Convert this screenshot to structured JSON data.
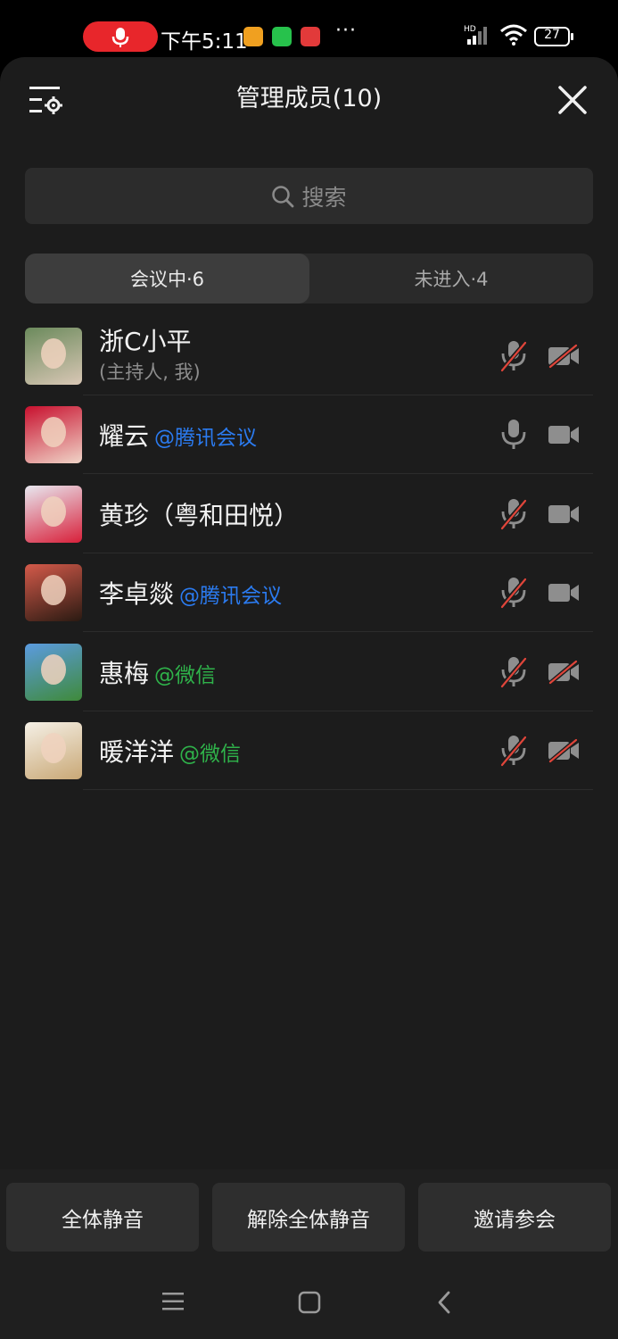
{
  "status_bar": {
    "time": "下午5:11",
    "battery": "27",
    "network": "HD",
    "more": "···"
  },
  "header": {
    "title": "管理成员(10)"
  },
  "search": {
    "placeholder": "搜索"
  },
  "tabs": [
    {
      "label": "会议中·6",
      "active": true
    },
    {
      "label": "未进入·4",
      "active": false
    }
  ],
  "members": [
    {
      "name": "浙C小平",
      "tag": "",
      "sub": "(主持人, 我)",
      "mic": "muted",
      "camera": "off",
      "avatar_colors": [
        "#6b8a5c",
        "#d9c7b5"
      ]
    },
    {
      "name": "耀云",
      "tag": "@腾讯会议",
      "tag_color": "#2b7bf0",
      "sub": "",
      "mic": "on",
      "camera": "on",
      "avatar_colors": [
        "#c8102e",
        "#f0d5c8"
      ]
    },
    {
      "name": "黄珍（粤和田悦）",
      "tag": "",
      "sub": "",
      "mic": "muted",
      "camera": "on",
      "avatar_colors": [
        "#e8e8f0",
        "#d8203a"
      ]
    },
    {
      "name": "李卓燚",
      "tag": "@腾讯会议",
      "tag_color": "#2b7bf0",
      "sub": "",
      "mic": "muted",
      "camera": "on",
      "avatar_colors": [
        "#d45a4a",
        "#2a1a12"
      ]
    },
    {
      "name": "惠梅",
      "tag": "@微信",
      "tag_color": "#2fb24a",
      "sub": "",
      "mic": "muted",
      "camera": "off",
      "avatar_colors": [
        "#5b9be0",
        "#3f8a3a"
      ]
    },
    {
      "name": "暖洋洋",
      "tag": "@微信",
      "tag_color": "#2fb24a",
      "sub": "",
      "mic": "muted",
      "camera": "off",
      "avatar_colors": [
        "#f5f0e6",
        "#c9a876"
      ]
    }
  ],
  "actions": {
    "mute_all": "全体静音",
    "unmute_all": "解除全体静音",
    "invite": "邀请参会"
  },
  "colors": {
    "muted_slash": "#e0453a",
    "icon_gray": "#8e8e8e",
    "record_red": "#e8262b"
  }
}
